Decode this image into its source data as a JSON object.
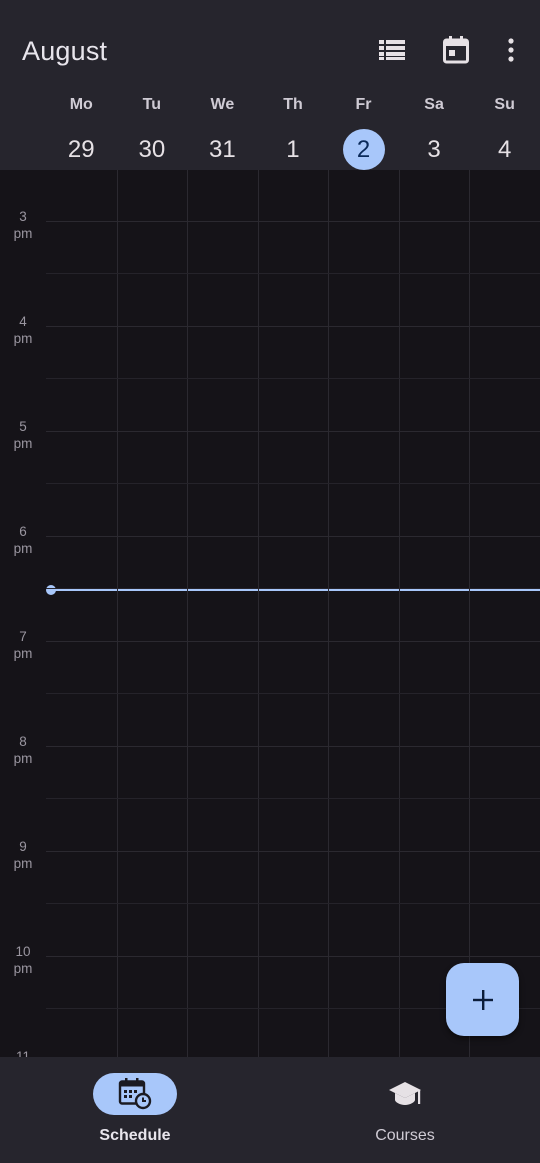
{
  "header": {
    "month": "August",
    "icons": [
      "view-list-icon",
      "calendar-today-icon",
      "more-vert-icon"
    ]
  },
  "week": {
    "days": [
      {
        "name": "Mo",
        "num": "29"
      },
      {
        "name": "Tu",
        "num": "30"
      },
      {
        "name": "We",
        "num": "31"
      },
      {
        "name": "Th",
        "num": "1"
      },
      {
        "name": "Fr",
        "num": "2"
      },
      {
        "name": "Sa",
        "num": "3"
      },
      {
        "name": "Su",
        "num": "4"
      }
    ],
    "today_index": 4
  },
  "timeline": {
    "hours": [
      {
        "h": "3",
        "p": "pm"
      },
      {
        "h": "4",
        "p": "pm"
      },
      {
        "h": "5",
        "p": "pm"
      },
      {
        "h": "6",
        "p": "pm"
      },
      {
        "h": "7",
        "p": "pm"
      },
      {
        "h": "8",
        "p": "pm"
      },
      {
        "h": "9",
        "p": "pm"
      },
      {
        "h": "10",
        "p": "pm"
      },
      {
        "h": "11",
        "p": ""
      }
    ]
  },
  "fab": {
    "icon": "plus-icon"
  },
  "nav": {
    "items": [
      {
        "label": "Schedule",
        "icon": "schedule-calendar-icon",
        "active": true
      },
      {
        "label": "Courses",
        "icon": "graduation-cap-icon",
        "active": false
      }
    ]
  },
  "colors": {
    "accent": "#a8c7fa",
    "surface": "#26252d",
    "background": "#151318"
  }
}
